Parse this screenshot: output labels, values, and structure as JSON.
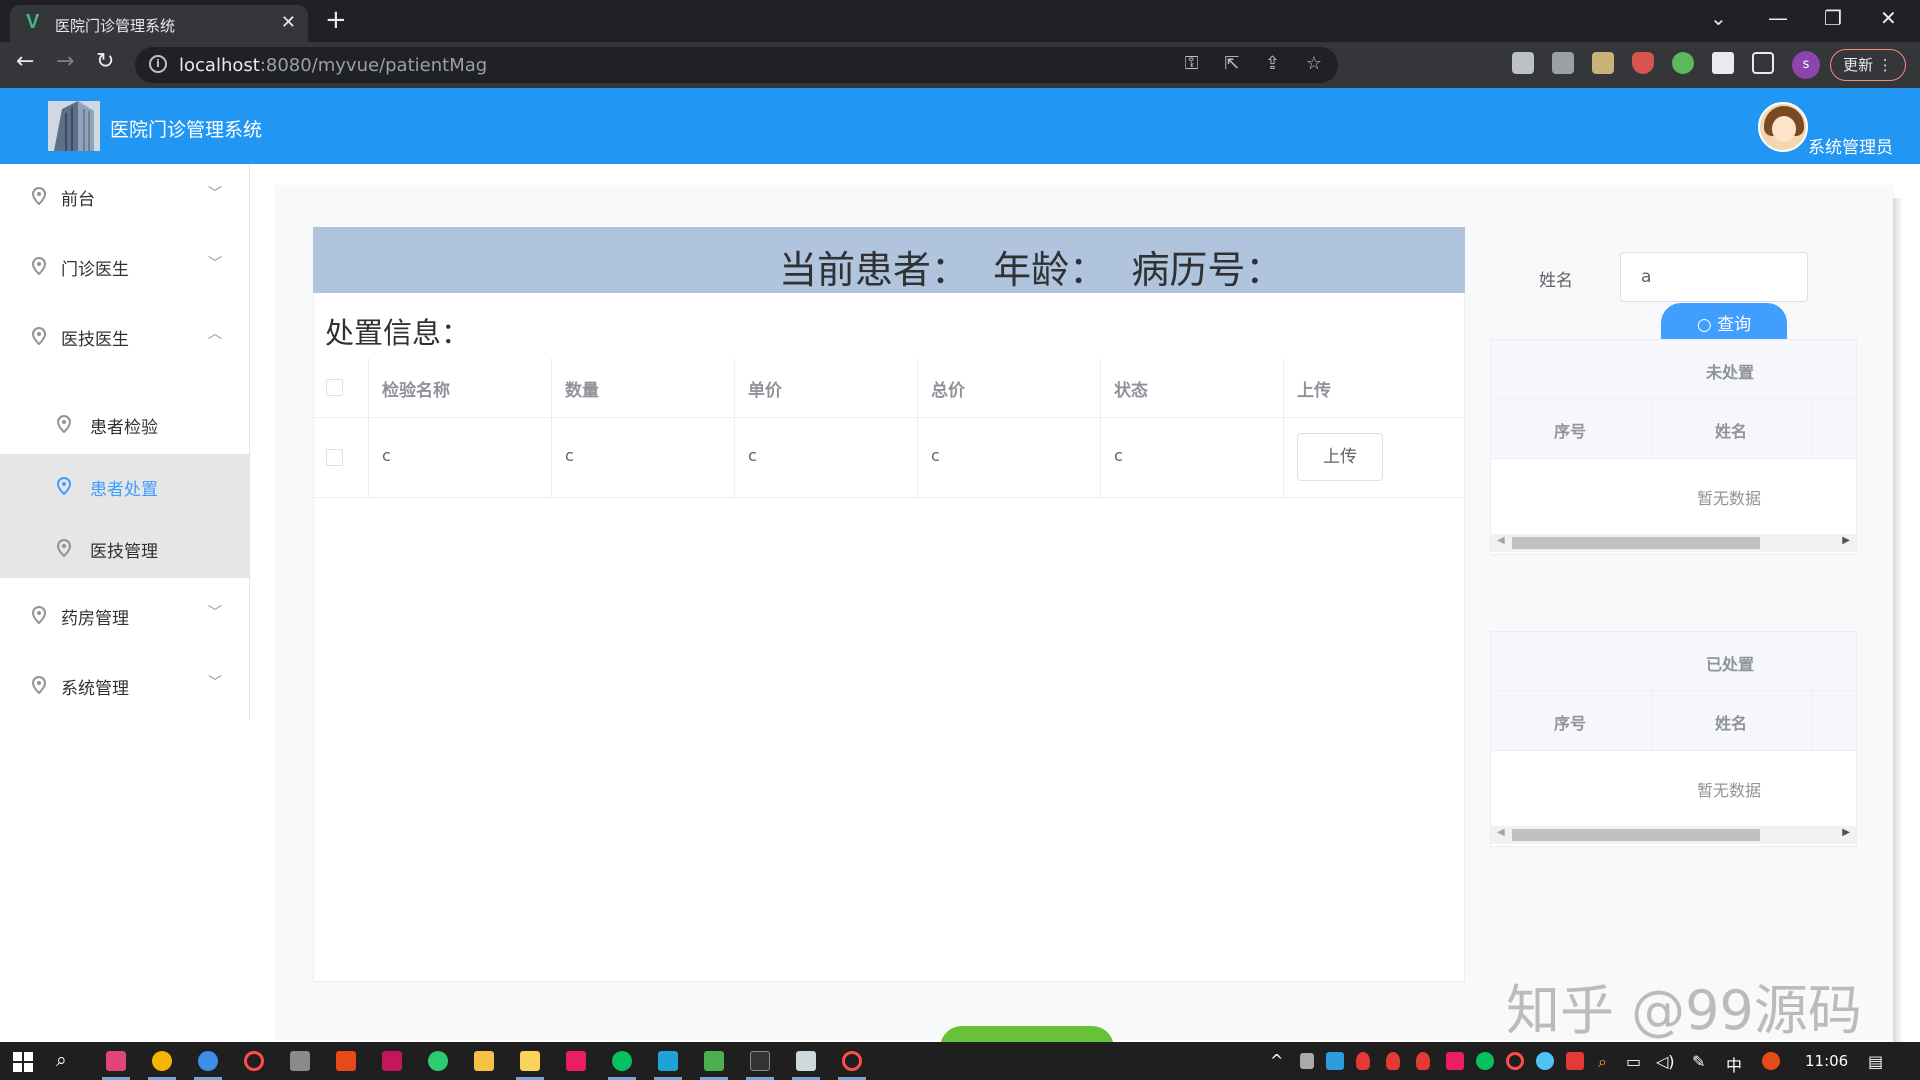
{
  "browser": {
    "tab_title": "医院门诊管理系统",
    "tab_favicon": "V",
    "url_host": "localhost",
    "url_path": ":8080/myvue/patientMag",
    "profile_initial": "s",
    "update_label": "更新"
  },
  "header": {
    "title": "医院门诊管理系统",
    "user": "系统管理员"
  },
  "sidebar": {
    "items": [
      {
        "label": "前台"
      },
      {
        "label": "门诊医生"
      },
      {
        "label": "医技医生"
      },
      {
        "label": "患者检验"
      },
      {
        "label": "患者处置"
      },
      {
        "label": "医技管理"
      },
      {
        "label": "药房管理"
      },
      {
        "label": "系统管理"
      }
    ]
  },
  "main": {
    "patient_bar": "当前患者：  年龄：  病历号：",
    "section_title": "处置信息：",
    "table": {
      "columns": [
        "检验名称",
        "数量",
        "单价",
        "总价",
        "状态",
        "上传"
      ],
      "rows": [
        {
          "name": "c",
          "qty": "c",
          "price": "c",
          "total": "c",
          "status": "c",
          "action": "上传"
        }
      ]
    }
  },
  "right": {
    "name_label": "姓名",
    "name_value": "a",
    "query_label": "查询",
    "untreated": {
      "title": "未处置",
      "col1": "序号",
      "col2": "姓名",
      "empty": "暂无数据"
    },
    "treated": {
      "title": "已处置",
      "col1": "序号",
      "col2": "姓名",
      "empty": "暂无数据"
    }
  },
  "watermark": "知乎 @99源码",
  "taskbar": {
    "ime": "中",
    "time": "11:06"
  },
  "colors": {
    "header_blue": "#2196f3",
    "patient_bar": "#b0c4de",
    "active_menu": "#409eff",
    "primary_button": "#409eff",
    "success_button": "#67c23a"
  }
}
